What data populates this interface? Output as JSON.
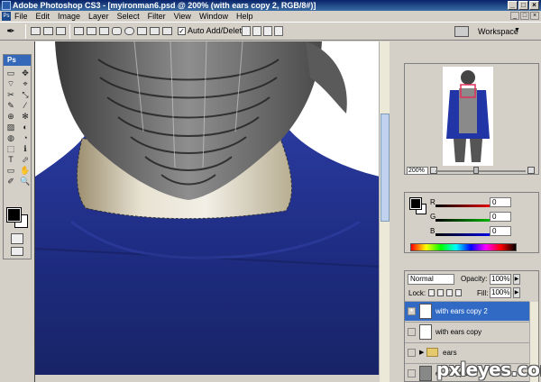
{
  "window": {
    "title": "Adobe Photoshop CS3 - [myironman6.psd @ 200% (with ears copy 2, RGB/8#)]",
    "buttons": [
      "_",
      "□",
      "×"
    ]
  },
  "menu": {
    "items": [
      "File",
      "Edit",
      "Image",
      "Layer",
      "Select",
      "Filter",
      "View",
      "Window",
      "Help"
    ],
    "doc_buttons": [
      "_",
      "□",
      "×"
    ]
  },
  "options": {
    "tool_icon": "pen-tool-icon",
    "auto_add_delete_checked": true,
    "auto_add_delete_label": "Auto Add/Delete",
    "workspace_label": "Workspace"
  },
  "toolbox": {
    "header": "Ps",
    "tools": [
      "▭",
      "✥",
      "⌔",
      "⌖",
      "✂",
      "⤡",
      "✎",
      "⁄",
      "⊕",
      "✻",
      "▨",
      "◐",
      "◍",
      "◔",
      "⬚",
      "ℹ",
      "T",
      "⬀",
      "▭",
      "✋",
      "✐",
      "🔍"
    ],
    "foreground_color": "#000000",
    "background_color": "#ffffff"
  },
  "navigator": {
    "zoom": "200%"
  },
  "color_panel": {
    "channels": [
      {
        "label": "R",
        "value": "0",
        "color": "#d80000"
      },
      {
        "label": "G",
        "value": "0",
        "color": "#008800"
      },
      {
        "label": "B",
        "value": "0",
        "color": "#0000c8"
      }
    ]
  },
  "layers_panel": {
    "blend_mode": "Normal",
    "opacity_label": "Opacity:",
    "opacity": "100%",
    "lock_label": "Lock:",
    "fill_label": "Fill:",
    "fill": "100%",
    "layers": [
      {
        "name": "with ears copy 2",
        "selected": true,
        "visible": true,
        "type": "layer"
      },
      {
        "name": "with ears copy",
        "selected": false,
        "visible": false,
        "type": "layer"
      },
      {
        "name": "ears",
        "selected": false,
        "visible": false,
        "type": "group"
      },
      {
        "name": "ear copy 3",
        "selected": false,
        "visible": false,
        "type": "layer"
      }
    ]
  },
  "watermark": "pxleyes.com"
}
